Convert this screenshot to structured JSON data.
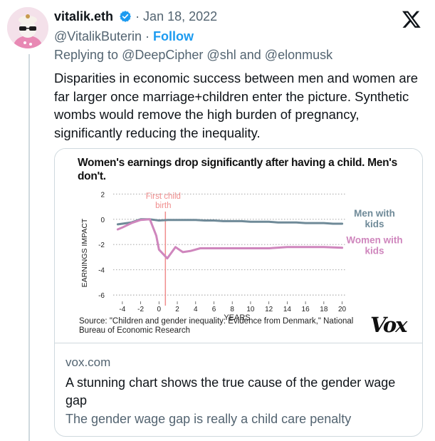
{
  "author": {
    "display_name": "vitalik.eth",
    "handle": "@VitalikButerin",
    "date": "· Jan 18, 2022",
    "follow_label": "Follow",
    "separator": "·"
  },
  "reply": {
    "prefix": "Replying to",
    "mentions": [
      "@DeepCipher",
      "@shl",
      "and",
      "@elonmusk"
    ]
  },
  "tweet_text": "Disparities in economic success between men and women are far larger once marriage+children enter the picture. Synthetic wombs would remove the high burden of pregnancy, significantly reducing the inequality.",
  "link_card": {
    "domain": "vox.com",
    "title": "A stunning chart shows the true cause of the gender wage gap",
    "description": "The gender wage gap is really a child care penalty"
  },
  "colors": {
    "accent": "#1d9bf0",
    "men_line": "#6f8a98",
    "women_line": "#cf86bd",
    "birth_line": "#f08d8d"
  },
  "chart_data": {
    "type": "line",
    "title": "Women's earnings drop significantly after having a child. Men's don't.",
    "xlabel": "YEARS",
    "ylabel": "EARNINGS IMPACT",
    "xlim": [
      -5,
      20.5
    ],
    "ylim": [
      -6.5,
      2.3
    ],
    "xticks": [
      -4,
      -2,
      0,
      2,
      4,
      6,
      8,
      10,
      12,
      14,
      16,
      18,
      20
    ],
    "yticks": [
      2,
      0,
      -2,
      -4,
      -6
    ],
    "grid": "horizontal dotted",
    "annotation": {
      "label": "First child birth",
      "x": 0.7
    },
    "series": [
      {
        "name": "Men with kids",
        "color": "#6f8a98",
        "x": [
          -4.5,
          -4,
          -3,
          -2,
          -1,
          0,
          1,
          2,
          3,
          4,
          5,
          6,
          7,
          8,
          9,
          10,
          11,
          12,
          13,
          14,
          15,
          16,
          17,
          18,
          19,
          20
        ],
        "y": [
          -0.4,
          -0.35,
          -0.25,
          0.0,
          0.0,
          -0.1,
          -0.05,
          -0.05,
          -0.05,
          -0.05,
          -0.1,
          -0.1,
          -0.15,
          -0.15,
          -0.15,
          -0.2,
          -0.2,
          -0.2,
          -0.25,
          -0.25,
          -0.25,
          -0.3,
          -0.3,
          -0.3,
          -0.35,
          -0.35
        ]
      },
      {
        "name": "Women with kids",
        "color": "#cf86bd",
        "x": [
          -4.5,
          -4,
          -3,
          -2,
          -1,
          -0.3,
          0,
          0.9,
          1.8,
          2.6,
          3.5,
          4.5,
          5.5,
          6.5,
          8,
          10,
          12,
          14,
          16,
          18,
          20
        ],
        "y": [
          -0.8,
          -0.65,
          -0.3,
          -0.05,
          0.0,
          -1.3,
          -2.4,
          -3.1,
          -2.2,
          -2.6,
          -2.5,
          -2.3,
          -2.3,
          -2.3,
          -2.3,
          -2.3,
          -2.3,
          -2.2,
          -2.2,
          -2.2,
          -2.25
        ]
      }
    ],
    "source": "Source: \"Children and gender inequality: Evidence from Denmark,\" National Bureau of Economic Research",
    "brand": "Vox"
  }
}
